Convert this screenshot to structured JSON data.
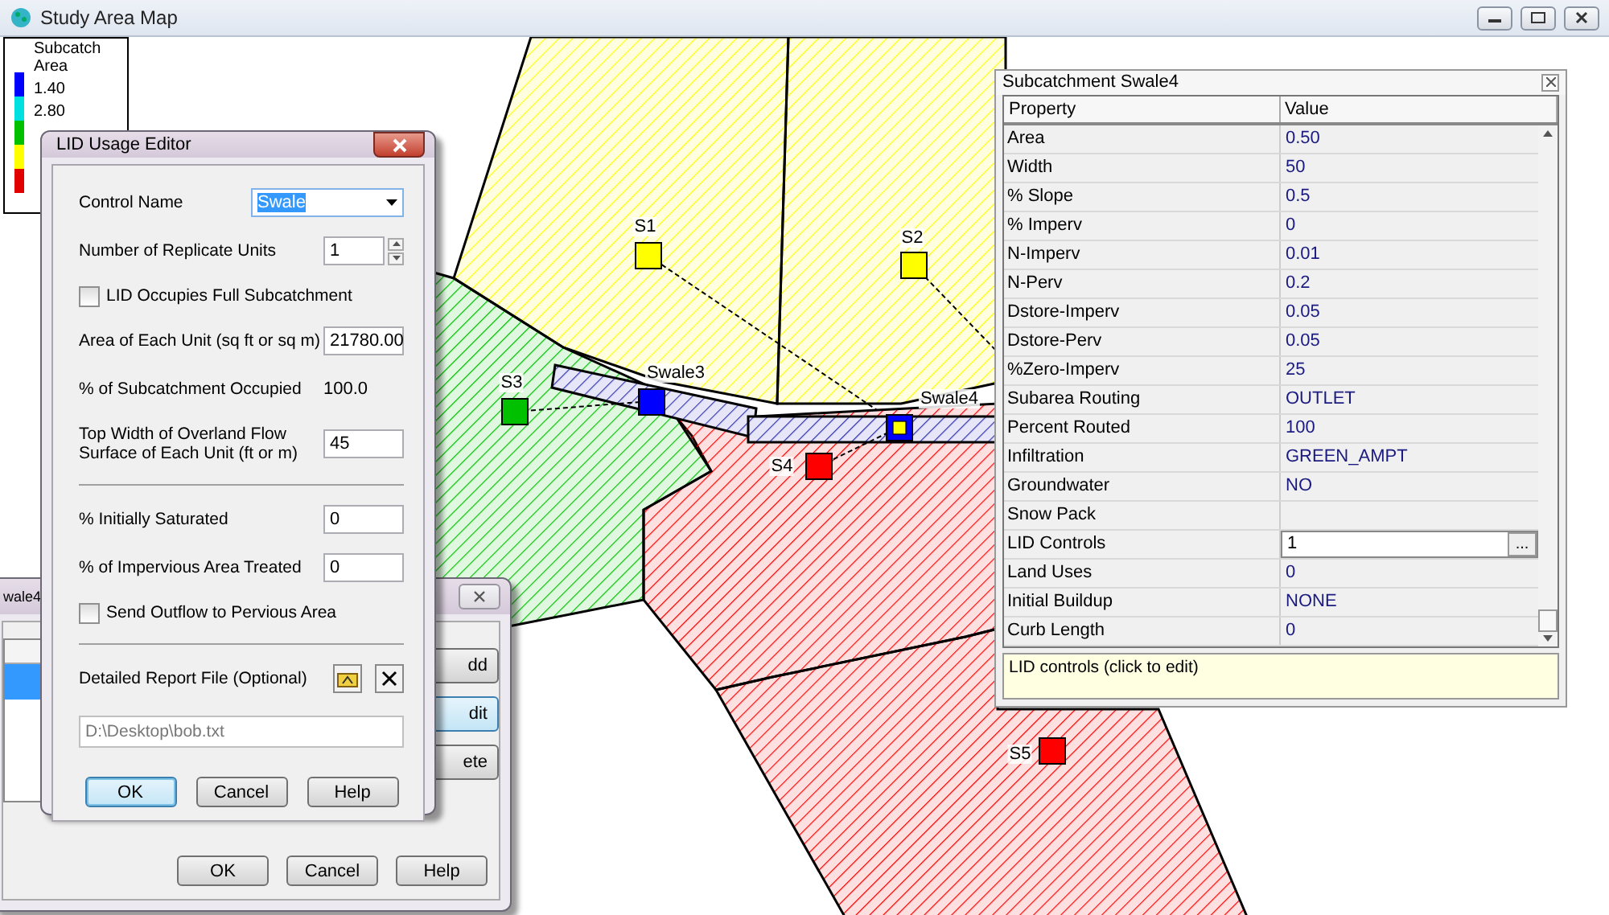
{
  "window": {
    "title": "Study Area Map"
  },
  "legend": {
    "title": "Subcatch Area",
    "bands": [
      {
        "color": "#0000ff"
      },
      {
        "color": "#00e0e0"
      },
      {
        "color": "#00c000"
      },
      {
        "color": "#ffff00"
      },
      {
        "color": "#e00000"
      }
    ],
    "labels": [
      "1.40",
      "2.80"
    ]
  },
  "map": {
    "subcatchments": [
      {
        "label": "S1",
        "color": "#ffff00"
      },
      {
        "label": "S2",
        "color": "#ffff00"
      },
      {
        "label": "S3",
        "color": "#00c000"
      },
      {
        "label": "S4",
        "color": "#ff0000"
      },
      {
        "label": "S5",
        "color": "#ff0000"
      }
    ],
    "swales": [
      {
        "label": "Swale3",
        "selected": false
      },
      {
        "label": "Swale4",
        "selected": true
      }
    ]
  },
  "back_dialog": {
    "title": "wale4",
    "side_buttons": [
      {
        "label": "dd",
        "focused": false
      },
      {
        "label": "dit",
        "focused": true
      },
      {
        "label": "ete",
        "focused": false
      }
    ],
    "buttons": [
      "OK",
      "Cancel",
      "Help"
    ]
  },
  "lid_editor": {
    "title": "LID Usage Editor",
    "control_name": {
      "label": "Control Name",
      "value": "Swale"
    },
    "replicate_units": {
      "label": "Number of Replicate Units",
      "value": "1"
    },
    "full_subcatchment": {
      "label": "LID Occupies Full Subcatchment",
      "checked": false
    },
    "unit_area": {
      "label": "Area of Each Unit (sq ft or sq m)",
      "value": "21780.00"
    },
    "occupied": {
      "label": "% of Subcatchment Occupied",
      "value": "100.0"
    },
    "top_width": {
      "label": "Top Width of Overland Flow Surface of Each Unit (ft or m)",
      "value": "45"
    },
    "initially_saturated": {
      "label": "% Initially Saturated",
      "value": "0"
    },
    "impervious_treated": {
      "label": "% of Impervious Area Treated",
      "value": "0"
    },
    "send_outflow": {
      "label": "Send Outflow to Pervious Area",
      "checked": false
    },
    "report_file": {
      "label": "Detailed Report File (Optional)",
      "value": "D:\\Desktop\\bob.txt",
      "disabled": true
    },
    "buttons": [
      {
        "label": "OK",
        "default": true
      },
      {
        "label": "Cancel",
        "default": false
      },
      {
        "label": "Help",
        "default": false
      }
    ]
  },
  "property_panel": {
    "title": "Subcatchment Swale4",
    "columns": [
      "Property",
      "Value"
    ],
    "rows": [
      {
        "property": "Area",
        "value": "0.50",
        "kind": "text"
      },
      {
        "property": "Width",
        "value": "50",
        "kind": "text"
      },
      {
        "property": "% Slope",
        "value": "0.5",
        "kind": "text"
      },
      {
        "property": "% Imperv",
        "value": "0",
        "kind": "text"
      },
      {
        "property": "N-Imperv",
        "value": "0.01",
        "kind": "text"
      },
      {
        "property": "N-Perv",
        "value": "0.2",
        "kind": "text"
      },
      {
        "property": "Dstore-Imperv",
        "value": "0.05",
        "kind": "text"
      },
      {
        "property": "Dstore-Perv",
        "value": "0.05",
        "kind": "text"
      },
      {
        "property": "%Zero-Imperv",
        "value": "25",
        "kind": "text"
      },
      {
        "property": "Subarea Routing",
        "value": "OUTLET",
        "kind": "text"
      },
      {
        "property": "Percent Routed",
        "value": "100",
        "kind": "text"
      },
      {
        "property": "Infiltration",
        "value": "GREEN_AMPT",
        "kind": "text"
      },
      {
        "property": "Groundwater",
        "value": "NO",
        "kind": "text"
      },
      {
        "property": "Snow Pack",
        "kind": "text"
      },
      {
        "property": "LID Controls",
        "value": "1",
        "kind": "editor",
        "button": "..."
      },
      {
        "property": "Land Uses",
        "value": "0",
        "kind": "text"
      },
      {
        "property": "Initial Buildup",
        "value": "NONE",
        "kind": "text"
      },
      {
        "property": "Curb Length",
        "value": "0",
        "kind": "text"
      }
    ],
    "description": "LID controls (click to edit)"
  }
}
